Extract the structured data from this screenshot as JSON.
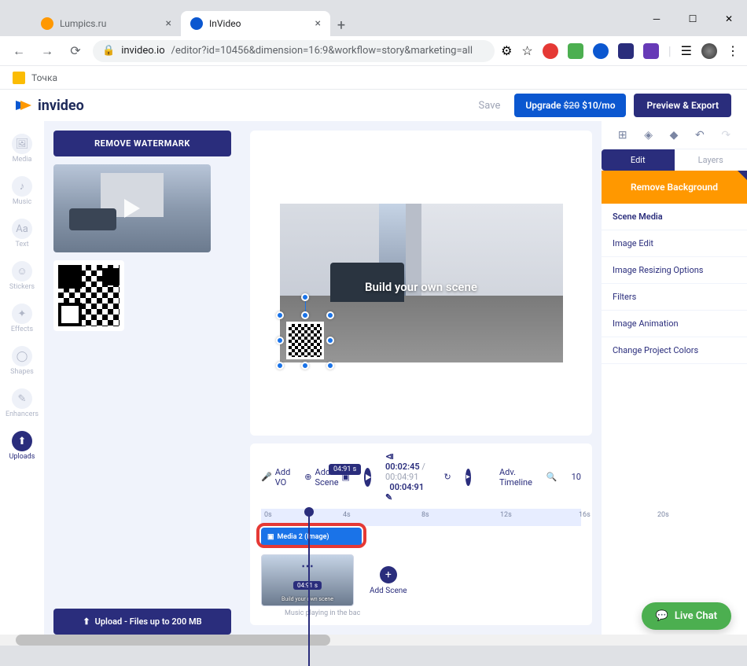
{
  "browser": {
    "tabs": [
      {
        "title": "Lumpics.ru",
        "favicon_color": "#ff9800"
      },
      {
        "title": "InVideo",
        "favicon_color": "#0b57d0"
      }
    ],
    "url_host": "invideo.io",
    "url_path": "/editor?id=10456&dimension=16:9&workflow=story&marketing=all",
    "bookmark": "Точка"
  },
  "header": {
    "logo": "invideo",
    "save": "Save",
    "upgrade_prefix": "Upgrade ",
    "upgrade_strike": "$20",
    "upgrade_price": " $10/mo",
    "export": "Preview & Export"
  },
  "sidenav": {
    "items": [
      {
        "label": "Media",
        "icon": "🖼"
      },
      {
        "label": "Music",
        "icon": "♪"
      },
      {
        "label": "Text",
        "icon": "Aa"
      },
      {
        "label": "Stickers",
        "icon": "☺"
      },
      {
        "label": "Effects",
        "icon": "✦"
      },
      {
        "label": "Shapes",
        "icon": "◯"
      },
      {
        "label": "Enhancers",
        "icon": "✎"
      },
      {
        "label": "Uploads",
        "icon": "⬆"
      }
    ]
  },
  "uploads": {
    "remove_watermark": "REMOVE WATERMARK",
    "upload_btn": "Upload - Files up to 200 MB"
  },
  "canvas": {
    "scene_text": "Build your own scene"
  },
  "timeline": {
    "add_vo": "Add VO",
    "add_scene_tool": "Add Scene",
    "duration_badge": "04:91 s",
    "current": "00:02:45",
    "total": "00:04:91",
    "frame": "00:04:91",
    "adv": "Adv. Timeline",
    "zoom": "10",
    "ticks": [
      "0s",
      "4s",
      "8s",
      "12s",
      "16s",
      "20s"
    ],
    "clip_label": "Media 2 (Image)",
    "scene_duration": "04:91 s",
    "scene_caption": "Build your own scene",
    "add_scene": "Add Scene",
    "music_hint": "Music playing in the bac"
  },
  "right": {
    "tabs": {
      "edit": "Edit",
      "layers": "Layers"
    },
    "remove_bg": "Remove Background",
    "sections": [
      "Scene Media",
      "Image Edit",
      "Image Resizing Options",
      "Filters",
      "Image Animation",
      "Change Project Colors"
    ]
  },
  "chat": "Live Chat"
}
